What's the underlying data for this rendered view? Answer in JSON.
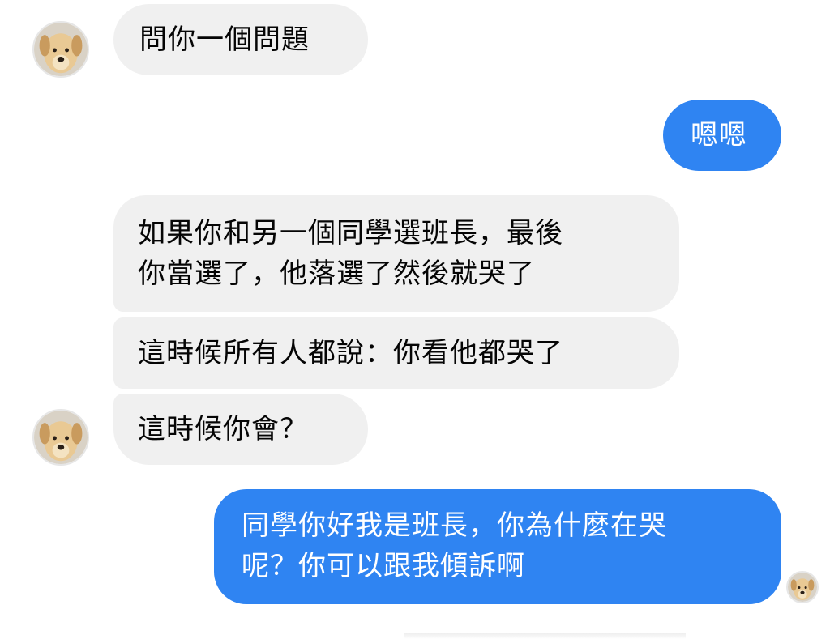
{
  "messages": [
    {
      "direction": "incoming",
      "lines": [
        "問你一個問題"
      ]
    },
    {
      "direction": "outgoing",
      "lines": [
        "嗯嗯"
      ]
    },
    {
      "direction": "incoming",
      "lines": [
        "如果你和另一個同學選班長，最後",
        "你當選了，他落選了然後就哭了"
      ]
    },
    {
      "direction": "incoming",
      "lines": [
        "這時候所有人都說：你看他都哭了"
      ]
    },
    {
      "direction": "incoming",
      "lines": [
        "這時候你會？"
      ]
    },
    {
      "direction": "outgoing",
      "lines": [
        "同學你好我是班長，你為什麼在哭",
        "呢？你可以跟我傾訴啊"
      ]
    }
  ],
  "avatars": {
    "contact": "dog-avatar-icon",
    "read_receipt": "dog-avatar-read-receipt-icon"
  },
  "colors": {
    "incoming_bubble": "#f0f0f0",
    "incoming_text": "#050505",
    "outgoing_bubble": "#2f84f2",
    "outgoing_text": "#ffffff",
    "background": "#ffffff"
  }
}
